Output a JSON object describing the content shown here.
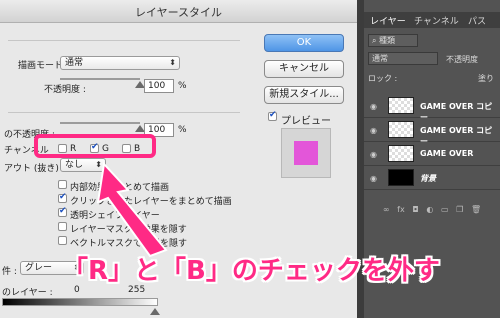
{
  "dialog": {
    "title": "レイヤースタイル",
    "blend_label": "描画モード :",
    "blend_value": "通常",
    "opacity_label": "不透明度 :",
    "opacity_value": "100",
    "percent": "%",
    "fill_opacity_label": "の不透明度 :",
    "fill_opacity_value": "100",
    "channels_label": "チャンネル",
    "channel_r": "R",
    "channel_g": "G",
    "channel_b": "B",
    "knockout_label": "アウト (抜き) :",
    "knockout_value": "なし",
    "options": [
      {
        "label": "内部効果をまとめて描画",
        "checked": false
      },
      {
        "label": "クリップされたレイヤーをまとめて描画",
        "checked": true
      },
      {
        "label": "透明シェイプレイヤー",
        "checked": true
      },
      {
        "label": "レイヤーマスクで効果を隠す",
        "checked": false
      },
      {
        "label": "ベクトルマスクで効果を隠す",
        "checked": false
      }
    ],
    "blend_if_label": "件 :",
    "blend_if_value": "グレー",
    "this_layer_label": "のレイヤー :",
    "this_layer_min": "0",
    "this_layer_max": "255",
    "ok_label": "OK",
    "cancel_label": "キャンセル",
    "new_style_label": "新規スタイル...",
    "preview_label": "プレビュー",
    "preview_checked": true,
    "preview_color": "#e356d9"
  },
  "panel": {
    "tabs": [
      "レイヤー",
      "チャンネル",
      "パス"
    ],
    "kind_filter": "種類",
    "blend_mode": "通常",
    "opacity_label": "不透明度",
    "lock_label": "ロック :",
    "fill_label": "塗り",
    "layers": [
      {
        "name": "GAME OVER コピー",
        "thumb": "transparent"
      },
      {
        "name": "GAME OVER コピー",
        "thumb": "transparent"
      },
      {
        "name": "GAME OVER",
        "thumb": "transparent"
      },
      {
        "name": "背景",
        "thumb": "black"
      }
    ]
  },
  "annotation": {
    "text": "「R」と「B」のチェックを外す",
    "color": "#ff2a85"
  }
}
